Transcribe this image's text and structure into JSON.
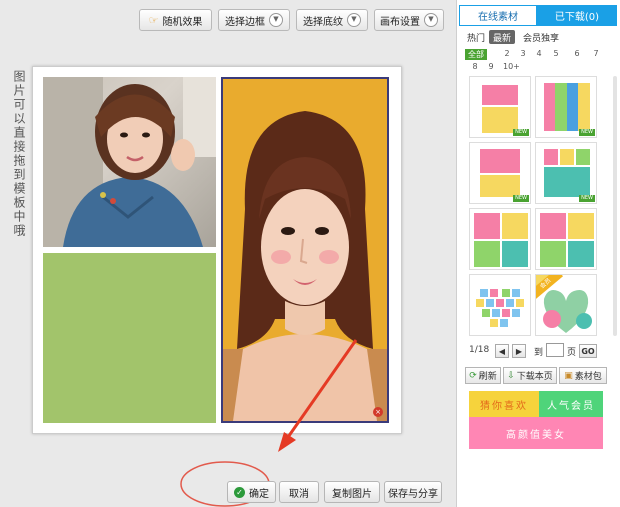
{
  "toolbar": {
    "random_label": "随机效果",
    "border_label": "选择边框",
    "bg_label": "选择底纹",
    "canvas_label": "画布设置"
  },
  "hint_text": "图片可以直接拖到模板中哦",
  "footer": {
    "confirm_label": "确定",
    "cancel_label": "取消",
    "copy_label": "复制图片",
    "save_label": "保存与分享"
  },
  "panel": {
    "tab_online": "在线素材",
    "tab_downloaded": "已下载(0)",
    "sub_hot": "热门",
    "sub_latest": "最新",
    "sub_vip": "会员独享",
    "filter_all": "全部",
    "filter_nums": [
      "2",
      "3",
      "4",
      "5",
      "6",
      "7",
      "8",
      "9",
      "10+"
    ],
    "new_badge": "NEW",
    "pagination": {
      "page": "1/18",
      "goto_label": "到",
      "page_unit": "页",
      "go_label": "GO"
    },
    "refresh_label": "刷新",
    "download_page_label": "下载本页",
    "material_pack_label": "素材包",
    "banner_1": "猜你喜欢",
    "banner_2": "人气会员",
    "banner_3": "高颜值美女",
    "heart_tag": "会员"
  },
  "colors": {
    "tab_active": "#1aa0e6",
    "selection": "#3a3a7a",
    "arrow": "#e53a24",
    "green_block": "#a2c46b",
    "photo_bg": "#e8a92c",
    "banner_yellow": "#f6d33c",
    "banner_green": "#4fd47a",
    "banner_pink": "#ff86b4"
  }
}
